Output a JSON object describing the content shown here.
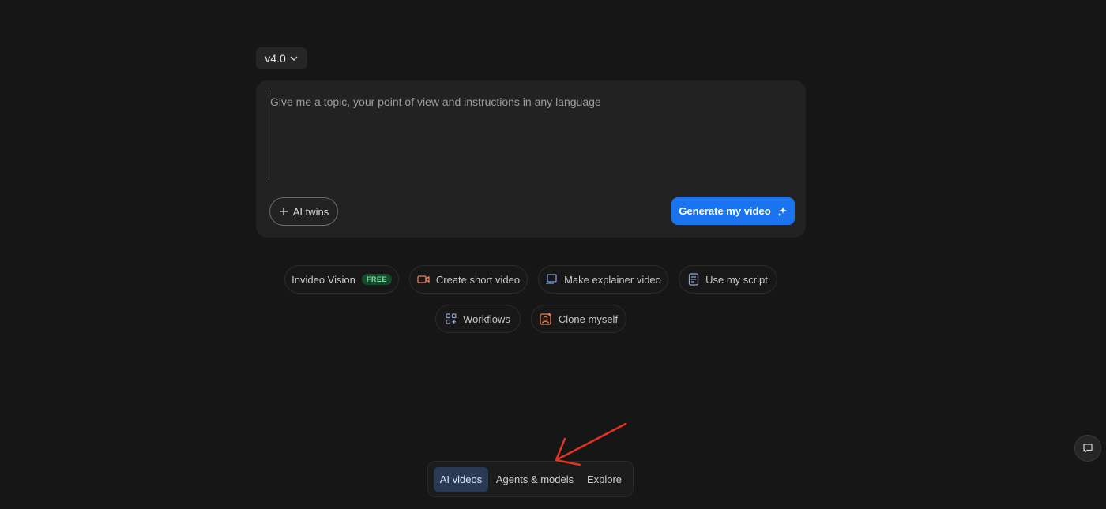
{
  "version": {
    "label": "v4.0"
  },
  "prompt": {
    "placeholder": "Give me a topic, your point of view and instructions in any language",
    "value": ""
  },
  "actions": {
    "ai_twins_label": "AI twins",
    "generate_label": "Generate my video"
  },
  "chips": {
    "invideo_vision": {
      "label": "Invideo Vision",
      "badge": "FREE",
      "icon": "eye-icon"
    },
    "create_short_video": {
      "label": "Create short video",
      "icon": "video-camera-icon"
    },
    "make_explainer_video": {
      "label": "Make explainer video",
      "icon": "presentation-icon"
    },
    "use_my_script": {
      "label": "Use my script",
      "icon": "document-icon"
    },
    "workflows": {
      "label": "Workflows",
      "icon": "grid-icon"
    },
    "clone_myself": {
      "label": "Clone myself",
      "icon": "clone-portrait-icon"
    }
  },
  "tabs": [
    {
      "label": "AI videos",
      "active": true
    },
    {
      "label": "Agents & models",
      "active": false
    },
    {
      "label": "Explore",
      "active": false
    }
  ],
  "colors": {
    "background": "#161616",
    "prompt_box": "#222222",
    "accent_blue": "#1a74f0",
    "annotation_arrow": "#e53322",
    "free_badge": "#174a2a"
  }
}
